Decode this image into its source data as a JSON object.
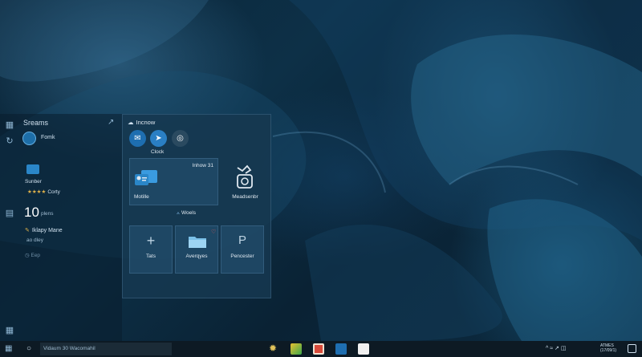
{
  "side_panel": {
    "title": "Sreams",
    "user_label": "Fomk",
    "item_label": "Sunber",
    "rating_stars": "★★★★",
    "rating_label": "Corty",
    "count_value": "10",
    "count_label": "plens",
    "note_title": "Iklapy Mane",
    "note_sub": "ao dley",
    "sched_label": "Eep"
  },
  "start_panel": {
    "header": "Incnow",
    "clock_label": "Clock",
    "big_tile": {
      "title": "Inhow 31",
      "label": "Motille"
    },
    "media_tile": {
      "label": "Meadsenbr"
    },
    "section_label": "Woels",
    "small_tiles": [
      {
        "label": "Tats",
        "icon": "plus-icon"
      },
      {
        "label": "Averqyes",
        "icon": "folder-icon"
      },
      {
        "label": "Pencester",
        "icon": "p-icon"
      }
    ]
  },
  "taskbar": {
    "search_placeholder": "Vidaum 30 Wacomahil",
    "tray_symbols": "^ ≈ ↗ ◫",
    "time": "ATMES",
    "date": "(17/09/1)"
  },
  "colors": {
    "accent": "#2a86c8",
    "panel_bg": "#163850",
    "taskbar_bg": "#0d1a24",
    "star": "#e0b24a"
  }
}
